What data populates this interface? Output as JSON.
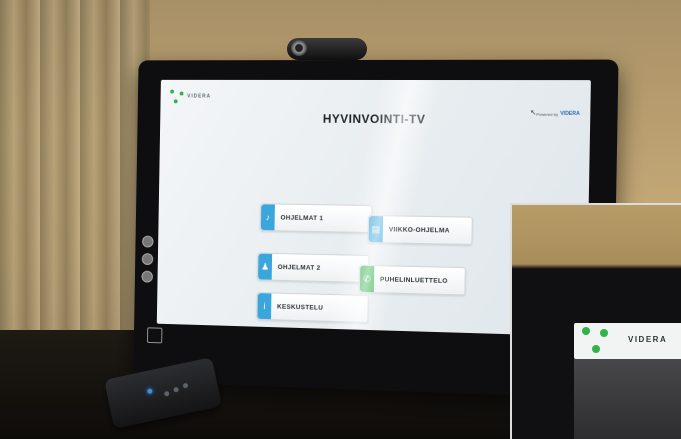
{
  "screen": {
    "app_logo_text": "VIDERA",
    "title": "HYVINVOINTI-TV",
    "powered_by": "Powered by",
    "powered_brand": "VIDERA",
    "menu": [
      {
        "label": "OHJELMAT 1",
        "icon": "microphone-icon",
        "color": "#3aa6dc"
      },
      {
        "label": "VIIKKO-OHJELMA",
        "icon": "calendar-icon",
        "color": "#3aa6dc"
      },
      {
        "label": "OHJELMAT 2",
        "icon": "people-icon",
        "color": "#3aa6dc"
      },
      {
        "label": "PUHELINLUETTELO",
        "icon": "phone-icon",
        "color": "#33b24c"
      },
      {
        "label": "KESKUSTELU",
        "icon": "info-icon",
        "color": "#3aa6dc"
      }
    ]
  },
  "inset": {
    "label": "VIDERA"
  }
}
